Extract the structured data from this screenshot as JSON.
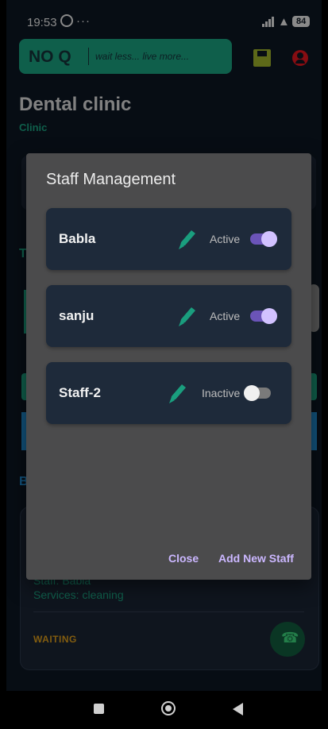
{
  "status_bar": {
    "time": "19:53",
    "dots": "···",
    "battery": "84"
  },
  "app_bar": {
    "logo": "NO Q",
    "tagline": "wait less... live more..."
  },
  "header": {
    "title": "Dental clinic",
    "subtitle": "Clinic"
  },
  "queue_card": {
    "staff_line": "Staff: Babla",
    "services_line": "Services: cleaning",
    "status": "WAITING"
  },
  "dialog": {
    "title": "Staff Management",
    "staff": [
      {
        "name": "Babla",
        "status": "Active",
        "active": true
      },
      {
        "name": "sanju",
        "status": "Active",
        "active": true
      },
      {
        "name": "Staff-2",
        "status": "Inactive",
        "active": false
      }
    ],
    "close_label": "Close",
    "add_label": "Add New Staff"
  },
  "colors": {
    "accent": "#1a9e7e",
    "toggle_on": "#6b54b8",
    "dialog_button": "#cbb7ff",
    "waiting": "#d99a1a"
  },
  "icons": [
    "whatsapp-icon",
    "signal-icon",
    "wifi-icon",
    "battery-icon",
    "save-icon",
    "account-icon",
    "edit-icon",
    "phone-icon",
    "nav-recents-icon",
    "nav-home-icon",
    "nav-back-icon"
  ]
}
